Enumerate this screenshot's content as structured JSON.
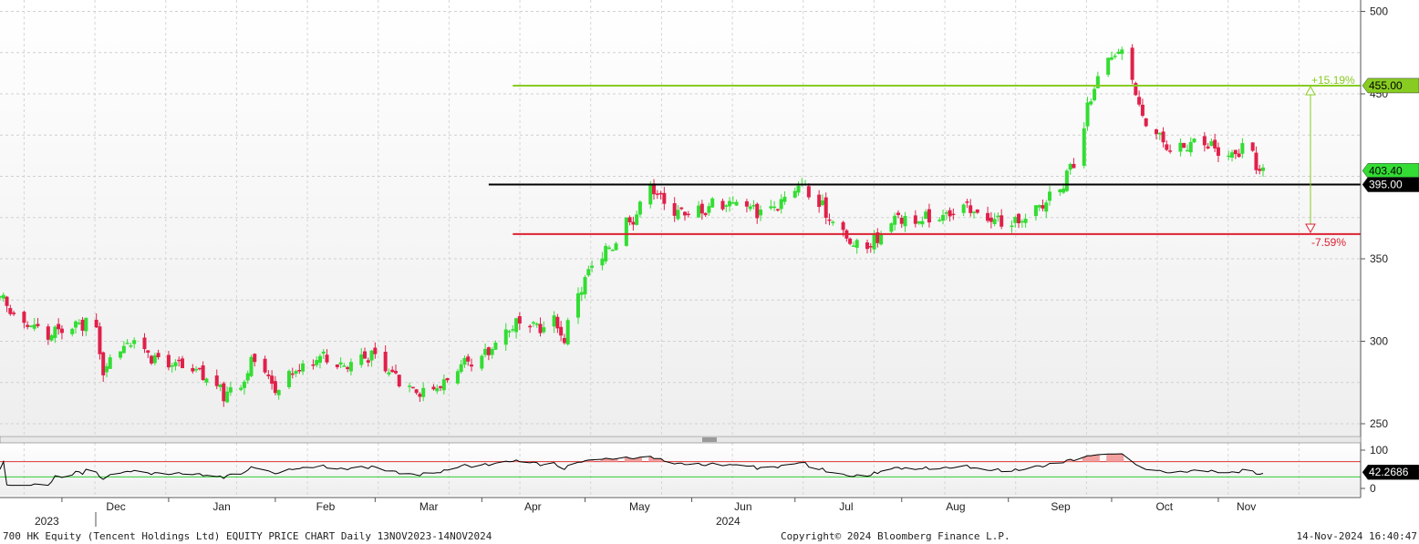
{
  "footer": {
    "title": "700 HK Equity (Tencent Holdings Ltd) EQUITY PRICE CHART  Daily 13NOV2023-14NOV2024",
    "copyright": "Copyright© 2024 Bloomberg Finance L.P.",
    "timestamp": "14-Nov-2024 16:40:47"
  },
  "colors": {
    "up": "#33dd33",
    "down": "#e0204a",
    "resistance": "#88cc22",
    "pivot": "#000000",
    "support": "#dd2233",
    "rsi_line": "#000000",
    "rsi_fill": "#f2a0a0"
  },
  "chart_data": [
    {
      "type": "candlestick",
      "title": "",
      "ylabel": "",
      "ylim": [
        240,
        500
      ],
      "y_ticks": [
        "500",
        "450",
        "350",
        "300",
        "250"
      ],
      "grid": true,
      "x_month_labels": [
        "Dec",
        "Jan",
        "Feb",
        "Mar",
        "Apr",
        "May",
        "Jun",
        "Jul",
        "Aug",
        "Sep",
        "Oct",
        "Nov"
      ],
      "x_year_labels": [
        "2023",
        "2024"
      ],
      "anchors": [
        [
          "2023-11-13",
          325
        ],
        [
          "2023-11-20",
          312
        ],
        [
          "2023-11-27",
          304
        ],
        [
          "2023-12-04",
          308
        ],
        [
          "2023-12-08",
          312
        ],
        [
          "2023-12-11",
          305
        ],
        [
          "2023-12-13",
          282
        ],
        [
          "2023-12-18",
          298
        ],
        [
          "2023-12-22",
          300
        ],
        [
          "2023-12-29",
          288
        ],
        [
          "2024-01-05",
          284
        ],
        [
          "2024-01-12",
          278
        ],
        [
          "2024-01-17",
          268
        ],
        [
          "2024-01-22",
          275
        ],
        [
          "2024-01-26",
          290
        ],
        [
          "2024-02-01",
          272
        ],
        [
          "2024-02-07",
          283
        ],
        [
          "2024-02-14",
          292
        ],
        [
          "2024-02-21",
          285
        ],
        [
          "2024-02-28",
          292
        ],
        [
          "2024-03-05",
          282
        ],
        [
          "2024-03-12",
          272
        ],
        [
          "2024-03-18",
          270
        ],
        [
          "2024-03-25",
          283
        ],
        [
          "2024-04-01",
          288
        ],
        [
          "2024-04-05",
          300
        ],
        [
          "2024-04-10",
          310
        ],
        [
          "2024-04-17",
          308
        ],
        [
          "2024-04-22",
          312
        ],
        [
          "2024-04-25",
          302
        ],
        [
          "2024-04-29",
          330
        ],
        [
          "2024-05-03",
          345
        ],
        [
          "2024-05-08",
          356
        ],
        [
          "2024-05-13",
          372
        ],
        [
          "2024-05-17",
          380
        ],
        [
          "2024-05-20",
          398
        ],
        [
          "2024-05-23",
          385
        ],
        [
          "2024-05-31",
          376
        ],
        [
          "2024-06-07",
          383
        ],
        [
          "2024-06-14",
          385
        ],
        [
          "2024-06-21",
          379
        ],
        [
          "2024-06-28",
          385
        ],
        [
          "2024-07-03",
          396
        ],
        [
          "2024-07-08",
          382
        ],
        [
          "2024-07-12",
          374
        ],
        [
          "2024-07-18",
          357
        ],
        [
          "2024-07-24",
          360
        ],
        [
          "2024-07-30",
          376
        ],
        [
          "2024-08-06",
          372
        ],
        [
          "2024-08-13",
          378
        ],
        [
          "2024-08-20",
          380
        ],
        [
          "2024-08-27",
          374
        ],
        [
          "2024-09-02",
          370
        ],
        [
          "2024-09-09",
          378
        ],
        [
          "2024-09-13",
          388
        ],
        [
          "2024-09-20",
          405
        ],
        [
          "2024-09-24",
          440
        ],
        [
          "2024-09-27",
          460
        ],
        [
          "2024-10-03",
          476
        ],
        [
          "2024-10-07",
          462
        ],
        [
          "2024-10-09",
          440
        ],
        [
          "2024-10-14",
          428
        ],
        [
          "2024-10-18",
          412
        ],
        [
          "2024-10-24",
          422
        ],
        [
          "2024-10-30",
          418
        ],
        [
          "2024-11-05",
          410
        ],
        [
          "2024-11-08",
          418
        ],
        [
          "2024-11-12",
          408
        ],
        [
          "2024-11-14",
          401
        ]
      ],
      "last_price": "403.40"
    },
    {
      "type": "line",
      "title": "",
      "ylim": [
        0,
        100
      ],
      "y_ticks": [
        "100",
        "0"
      ],
      "last_value": "42.2686",
      "upper_band": 70,
      "lower_band": 30
    }
  ],
  "levels": [
    {
      "value": 455,
      "label": "455.00",
      "color": "#88cc22",
      "start": "2024-04-10"
    },
    {
      "value": 395,
      "label": "395.00",
      "color": "#000000",
      "start": "2024-04-03"
    },
    {
      "value": 365,
      "label": "",
      "color": "#dd2233",
      "start": "2024-04-10"
    }
  ],
  "range_annotation": {
    "up_label": "+15.19%",
    "down_label": "-7.59%"
  }
}
